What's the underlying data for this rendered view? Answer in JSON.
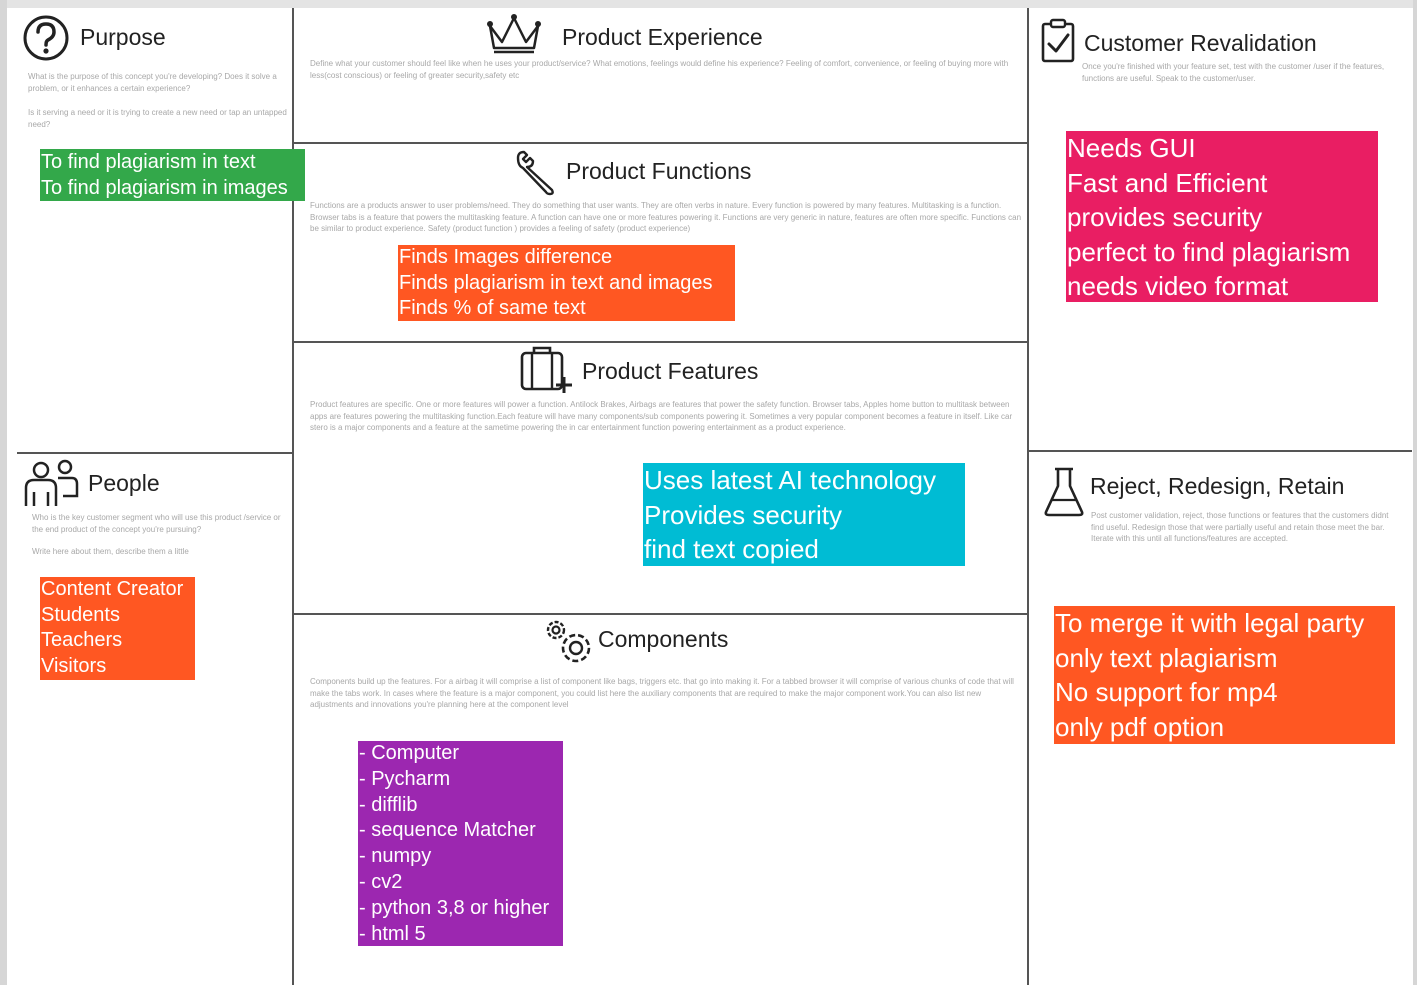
{
  "purpose": {
    "title": "Purpose",
    "desc_1": "What is the purpose of this concept you're developing? Does it solve a problem, or it enhances a certain experience?",
    "desc_2": "Is it serving a need or it is trying to create a new need or tap an untapped need?",
    "notes": [
      "To find plagiarism in text",
      "To find plagiarism in images"
    ],
    "icon": "question-mark-icon"
  },
  "people": {
    "title": "People",
    "desc_1": "Who is the key customer segment who will use this product /service or the end product of the concept you're pursuing?",
    "desc_2": "Write here about them, describe them a little",
    "notes": [
      "Content Creator",
      "Students",
      "Teachers",
      "Visitors"
    ],
    "icon": "people-icon"
  },
  "experience": {
    "title": "Product Experience",
    "desc": "Define what your customer should feel like when he uses your product/service? What emotions, feelings would define his experience? Feeling of comfort, convenience, or feeling of buying more with less(cost conscious) or feeling of greater security,safety etc",
    "icon": "crown-icon"
  },
  "functions": {
    "title": "Product Functions",
    "desc": "Functions are a products answer to user problems/need. They do something that user wants. They are often verbs in nature. Every function is powered by many features. Multitasking is a function. Browser tabs is a feature that powers the multitasking feature. A function can have one or more features powering it. Functions are very generic in nature, features are often more specific. Functions can be similar to product experience. Safety (product function ) provides a feeling of safety (product experience)",
    "notes": [
      "Finds Images difference",
      "Finds plagiarism in text and images",
      "Finds % of same text"
    ],
    "icon": "wrench-icon"
  },
  "features": {
    "title": "Product Features",
    "desc": "Product features are specific. One or more features will power a function. Antilock Brakes, Airbags are features that power the safety function. Browser tabs, Apples home button to multitask between apps are features powering the multitasking function.Each feature will have many components/sub components powering it. Sometimes a very popular component becomes a feature in itself. Like car stero is a major components and a feature at the sametime powering the in car entertainment function powering entertainment as a product experience.",
    "notes": [
      "Uses latest AI technology",
      "Provides security",
      "find text copied"
    ],
    "icon": "luggage-plus-icon"
  },
  "components": {
    "title": "Components",
    "desc": "Components build up the features. For a airbag it will comprise a list of component like bags, triggers etc. that go into making it. For a tabbed browser it will comprise of various chunks of code that will make the tabs work. In cases where the feature is a major component, you could list here the auxiliary components that are required to make the major component work.You can also list new adjustments and innovations you're planning here at the component level",
    "notes": [
      "Computer",
      "Pycharm",
      "difflib",
      "sequence Matcher",
      "numpy",
      "cv2",
      "python 3,8 or higher",
      "html 5"
    ],
    "icon": "gears-icon"
  },
  "revalidation": {
    "title": "Customer Revalidation",
    "desc": "Once you're finished with your feature set, test with the customer /user if the features, functions are useful. Speak to the customer/user.",
    "notes": [
      "Needs GUI",
      "Fast and Efficient",
      "provides security",
      "perfect to find plagiarism",
      "needs video format"
    ],
    "icon": "clipboard-check-icon"
  },
  "reject": {
    "title": "Reject, Redesign, Retain",
    "desc": "Post customer validation, reject, those functions or features that the customers didnt find useful. Redesign those that were partially useful and retain those meet the bar. Iterate with this until all functions/features are accepted.",
    "notes": [
      "To merge it with legal party",
      "only text plagiarism",
      "No support for mp4",
      "only pdf option"
    ],
    "icon": "flask-icon"
  },
  "colors": {
    "green": "#33a84a",
    "orange": "#ff5722",
    "pink": "#e91e63",
    "cyan": "#00bcd4",
    "purple": "#9c27b0"
  }
}
